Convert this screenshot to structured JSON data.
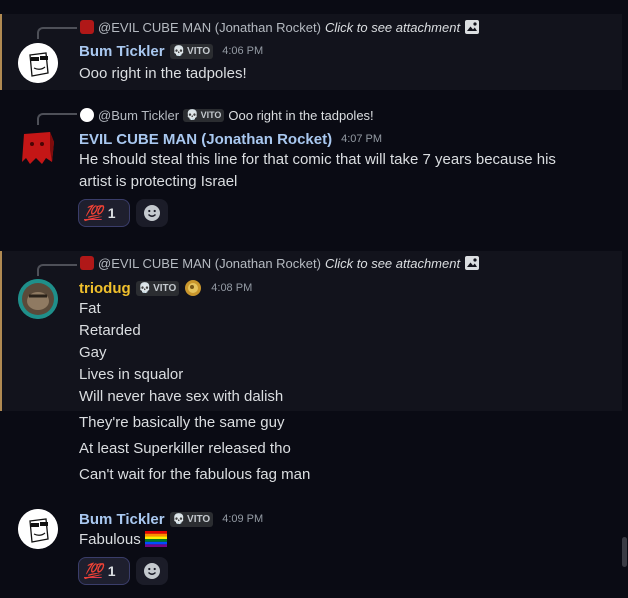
{
  "messages": [
    {
      "reply": {
        "name": "@EVIL CUBE MAN (Jonathan Rocket)",
        "text": "Click to see attachment",
        "icon": "image-icon"
      },
      "author": "Bum Tickler",
      "tag": "VITO",
      "time": "4:06 PM",
      "lines": [
        "Ooo right in the tadpoles!"
      ]
    },
    {
      "reply": {
        "name": "@Bum Tickler",
        "tag": "VITO",
        "text": "Ooo right in the tadpoles!"
      },
      "author": "EVIL CUBE MAN (Jonathan Rocket)",
      "time": "4:07 PM",
      "lines": [
        "He should steal this line for that comic that will take 7 years because his",
        "artist is protecting Israel"
      ],
      "reaction": {
        "emoji": "💯",
        "count": "1"
      }
    },
    {
      "reply": {
        "name": "@EVIL CUBE MAN (Jonathan Rocket)",
        "text": "Click to see attachment",
        "icon": "image-icon"
      },
      "author": "triodug",
      "tag": "VITO",
      "time": "4:08 PM",
      "lines": [
        "Fat",
        "Retarded",
        "Gay",
        "Lives in squalor",
        "Will never have sex with dalish"
      ],
      "followups": [
        "They're basically the same guy",
        "At least Superkiller released tho",
        "Can't wait for the fabulous fag man"
      ]
    },
    {
      "author": "Bum Tickler",
      "tag": "VITO",
      "time": "4:09 PM",
      "lines": [
        "Fabulous"
      ],
      "reaction": {
        "emoji": "💯",
        "count": "1"
      }
    }
  ],
  "colors": {
    "background": "#0a0b14",
    "highlight": "#12131c",
    "accent_bar": "#b08a52",
    "username_blue": "#a9c8f0",
    "username_gold": "#f0c02c",
    "reaction_border": "#3a3d6a"
  }
}
